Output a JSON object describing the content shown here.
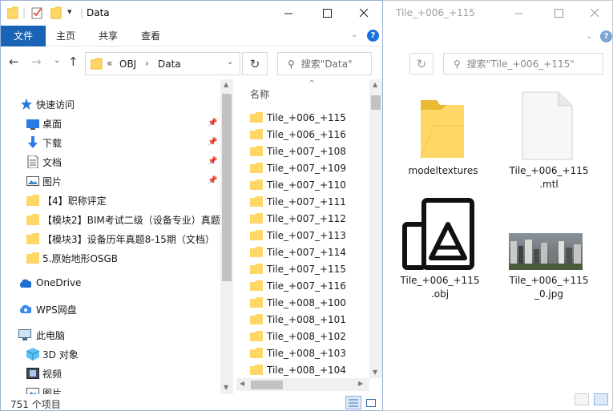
{
  "front": {
    "title": "Data",
    "ribbon": {
      "file": "文件",
      "home": "主页",
      "share": "共享",
      "view": "查看"
    },
    "address": {
      "prefix": "«",
      "crumbs": [
        "OBJ",
        "Data"
      ]
    },
    "search_placeholder": "搜索\"Data\"",
    "nav": {
      "quick_access": "快速访问",
      "pinned": [
        {
          "label": "桌面",
          "icon": "desktop-icon"
        },
        {
          "label": "下载",
          "icon": "download-icon"
        },
        {
          "label": "文档",
          "icon": "document-icon"
        },
        {
          "label": "图片",
          "icon": "pictures-icon"
        }
      ],
      "folders": [
        "【4】职称评定",
        "【模块2】BIM考试二级（设备专业）真题",
        "【模块3】设备历年真题8-15期（文档）",
        "5.原始地形OSGB"
      ],
      "onedrive": "OneDrive",
      "wps": "WPS网盘",
      "this_pc": "此电脑",
      "pc_items": [
        {
          "label": "3D 对象",
          "icon": "3d-objects-icon"
        },
        {
          "label": "视频",
          "icon": "video-icon"
        },
        {
          "label": "图片",
          "icon": "pictures-icon"
        }
      ]
    },
    "column_name": "名称",
    "files": [
      "Tile_+006_+115",
      "Tile_+006_+116",
      "Tile_+007_+108",
      "Tile_+007_+109",
      "Tile_+007_+110",
      "Tile_+007_+111",
      "Tile_+007_+112",
      "Tile_+007_+113",
      "Tile_+007_+114",
      "Tile_+007_+115",
      "Tile_+007_+116",
      "Tile_+008_+100",
      "Tile_+008_+101",
      "Tile_+008_+102",
      "Tile_+008_+103",
      "Tile_+008_+104"
    ],
    "status": "751 个项目"
  },
  "back": {
    "title": "Tile_+006_+115",
    "search_placeholder": "搜索\"Tile_+006_+115\"",
    "items": [
      {
        "line1": "modeltextures",
        "line2": "",
        "icon": "folder-icon"
      },
      {
        "line1": "Tile_+006_+115",
        "line2": ".mtl",
        "icon": "blank-file-icon"
      },
      {
        "line1": "Tile_+006_+115",
        "line2": ".obj",
        "icon": "3d-model-icon"
      },
      {
        "line1": "Tile_+006_+115",
        "line2": "_0.jpg",
        "icon": "image-thumbnail"
      }
    ]
  },
  "colors": {
    "accent": "#1a64b6",
    "folder": "#ffd767",
    "folder_dark": "#e8b931"
  }
}
